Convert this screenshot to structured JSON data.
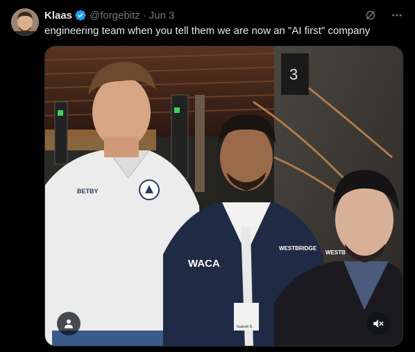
{
  "author": {
    "display_name": "Klaas",
    "handle": "@forgebitz",
    "separator": "·",
    "date": "Jun 3",
    "verified": true,
    "avatar_icon": "profile-photo"
  },
  "tweet": {
    "text": "engineering team when you tell them we are now an \"AI first\" company"
  },
  "media": {
    "type": "photo",
    "photo_labels": {
      "shirt_logo": "BETBY",
      "jacket_brand": "WESTBRIDGE",
      "jacket_logo": "WACA",
      "jacket_brand_right": "WESTB",
      "badge_name": "Gukesh D.",
      "floor_number": "3"
    },
    "tag_icon": "person-icon",
    "mute_icon": "speaker-muted-icon"
  },
  "colors": {
    "background": "#000000",
    "text_primary": "#e7e9ea",
    "text_secondary": "#71767b",
    "verified_blue": "#1d9bf0",
    "border": "#2f3336"
  }
}
